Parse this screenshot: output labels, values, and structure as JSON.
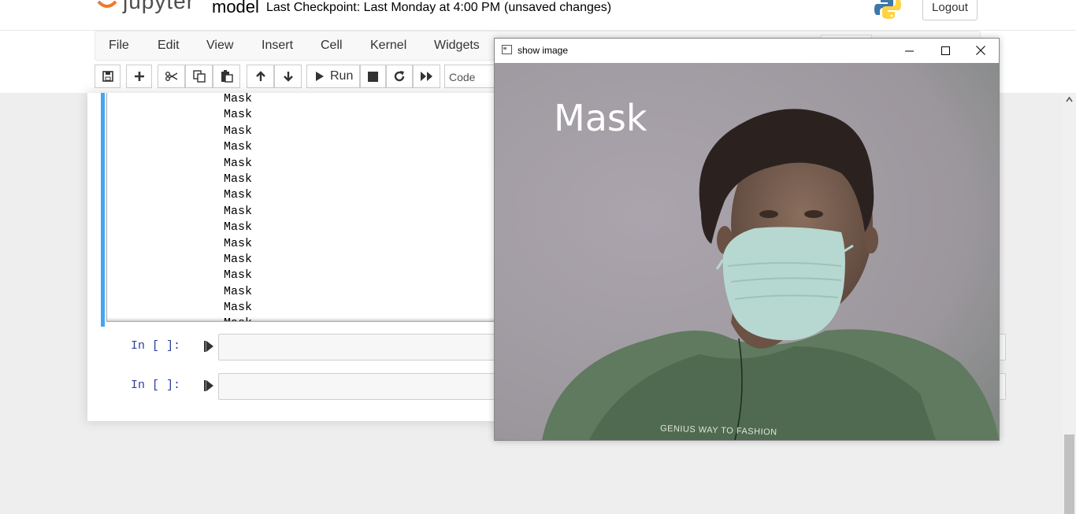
{
  "header": {
    "logo_text": "jupyter",
    "notebook_name": "model",
    "checkpoint": "Last Checkpoint: Last Monday at 4:00 PM",
    "unsaved": "(unsaved changes)",
    "logout_label": "Logout",
    "python_icon": "python-logo-icon"
  },
  "menubar": {
    "items": [
      "File",
      "Edit",
      "View",
      "Insert",
      "Cell",
      "Kernel",
      "Widgets"
    ]
  },
  "toolbar": {
    "run_label": "Run",
    "cell_type": "Code",
    "icons": [
      "save-icon",
      "add-icon",
      "cut-icon",
      "copy-icon",
      "paste-icon",
      "move-up-icon",
      "move-down-icon",
      "run-icon",
      "stop-icon",
      "restart-icon",
      "fast-forward-icon"
    ]
  },
  "output": {
    "lines": [
      "Mask",
      "Mask",
      "Mask",
      "Mask",
      "Mask",
      "Mask",
      "Mask",
      "Mask",
      "Mask",
      "Mask",
      "Mask",
      "Mask",
      "Mask",
      "Mask",
      "Mask"
    ]
  },
  "cells": [
    {
      "prompt": "In [ ]:"
    },
    {
      "prompt": "In [ ]:"
    }
  ],
  "image_window": {
    "title": "show image",
    "overlay_label": "Mask",
    "shirt_text": "GENIUS WAY TO FASHION"
  },
  "colors": {
    "selected_cell": "#42a5f5",
    "prompt": "#303f9f",
    "overlay_text": "#ffffff"
  }
}
